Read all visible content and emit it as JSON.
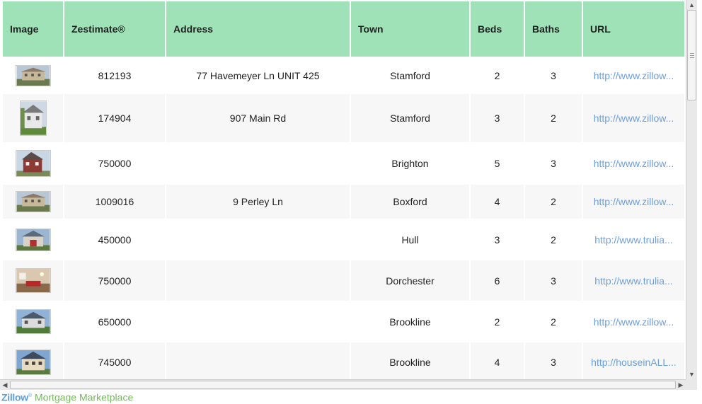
{
  "table": {
    "headers": [
      "Image",
      "Zestimate®",
      "Address",
      "Town",
      "Beds",
      "Baths",
      "URL"
    ],
    "rows": [
      {
        "image": "house-photo-icon",
        "zestimate": "812193",
        "address": "77 Havemeyer Ln UNIT 425",
        "town": "Stamford",
        "beds": "2",
        "baths": "3",
        "url": "http://www.zillow..."
      },
      {
        "image": "house-photo-icon",
        "zestimate": "174904",
        "address": "907 Main Rd",
        "town": "Stamford",
        "beds": "3",
        "baths": "2",
        "url": "http://www.zillow..."
      },
      {
        "image": "house-photo-icon",
        "zestimate": "750000",
        "address": "",
        "town": "Brighton",
        "beds": "5",
        "baths": "3",
        "url": "http://www.zillow..."
      },
      {
        "image": "house-photo-icon",
        "zestimate": "1009016",
        "address": "9 Perley Ln",
        "town": "Boxford",
        "beds": "4",
        "baths": "2",
        "url": "http://www.zillow..."
      },
      {
        "image": "house-photo-icon",
        "zestimate": "450000",
        "address": "",
        "town": "Hull",
        "beds": "3",
        "baths": "2",
        "url": "http://www.trulia..."
      },
      {
        "image": "house-photo-icon",
        "zestimate": "750000",
        "address": "",
        "town": "Dorchester",
        "beds": "6",
        "baths": "3",
        "url": "http://www.trulia..."
      },
      {
        "image": "house-photo-icon",
        "zestimate": "650000",
        "address": "",
        "town": "Brookline",
        "beds": "2",
        "baths": "2",
        "url": "http://www.zillow..."
      },
      {
        "image": "house-photo-icon",
        "zestimate": "745000",
        "address": "",
        "town": "Brookline",
        "beds": "4",
        "baths": "3",
        "url": "http://houseinALL..."
      }
    ]
  },
  "footer": {
    "brand": "Zillow",
    "tagline": "Mortgage Marketplace"
  },
  "colors": {
    "header_bg": "#9fe2b8",
    "link": "#6a9fe0",
    "brand_blue": "#5b9ed8",
    "brand_green": "#73b95a"
  }
}
